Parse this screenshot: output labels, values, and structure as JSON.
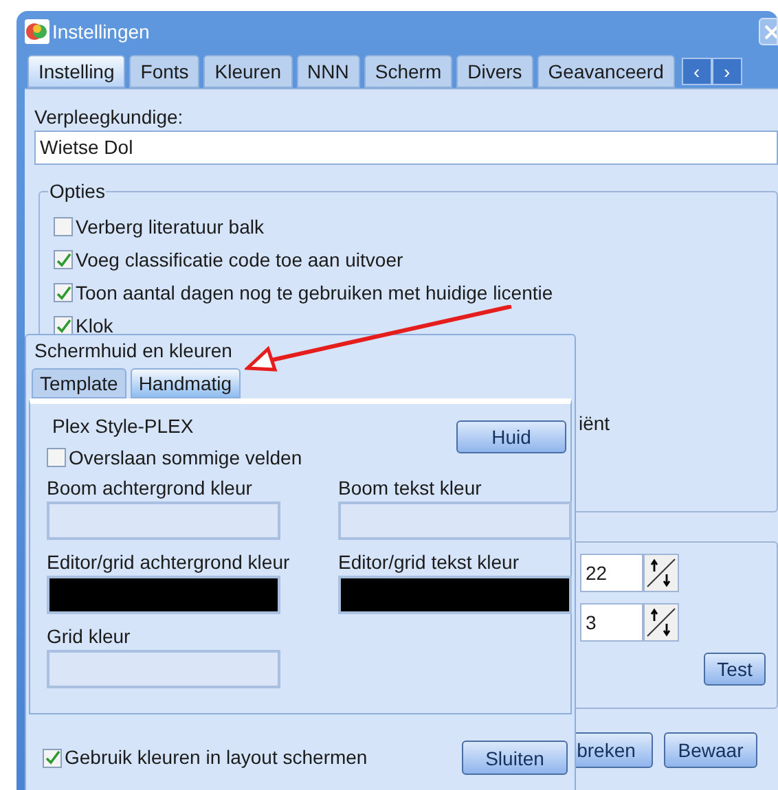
{
  "window": {
    "title": "Instellingen"
  },
  "tabs": [
    {
      "label": "Instelling",
      "selected": true
    },
    {
      "label": "Fonts",
      "selected": false
    },
    {
      "label": "Kleuren",
      "selected": false
    },
    {
      "label": "NNN",
      "selected": false
    },
    {
      "label": "Scherm",
      "selected": false
    },
    {
      "label": "Divers",
      "selected": false
    },
    {
      "label": "Geavanceerd",
      "selected": false
    }
  ],
  "tab_scroll": {
    "left": "‹",
    "right": "›"
  },
  "nurse": {
    "label": "Verpleegkundige:",
    "value": "Wietse Dol"
  },
  "options": {
    "title": "Opties",
    "items": [
      {
        "label": "Verberg literatuur balk",
        "checked": false
      },
      {
        "label": "Voeg classificatie code toe aan uitvoer",
        "checked": true
      },
      {
        "label": "Toon aantal dagen nog te gebruiken met huidige licentie",
        "checked": true
      },
      {
        "label": "Klok",
        "checked": true
      }
    ],
    "partial_text": "iënt"
  },
  "group_2": {
    "spinners": [
      {
        "value": "22"
      },
      {
        "value": "3"
      }
    ],
    "test_button": "Test"
  },
  "buttons": [
    "breken",
    "Bewaar"
  ],
  "skin_dialog": {
    "title": "Schermhuid en kleuren",
    "tabs": [
      {
        "label": "Template",
        "selected": false
      },
      {
        "label": "Handmatig",
        "selected": true
      }
    ],
    "style_name": "Plex Style-PLEX",
    "skin_button": "Huid",
    "skip_fields": {
      "label": "Overslaan sommige velden",
      "checked": false
    },
    "colors": [
      {
        "label": "Boom achtergrond kleur",
        "color": "#dae6f7"
      },
      {
        "label": "Boom tekst kleur",
        "color": "#dae6f7"
      },
      {
        "label": "Editor/grid achtergrond kleur",
        "color": "#000000"
      },
      {
        "label": "Editor/grid tekst kleur",
        "color": "#000000"
      },
      {
        "label": "Grid kleur",
        "color": "#dae6f7"
      }
    ],
    "use_colors": {
      "label": "Gebruik kleuren in layout schermen",
      "checked": true
    },
    "close_button": "Sluiten"
  }
}
